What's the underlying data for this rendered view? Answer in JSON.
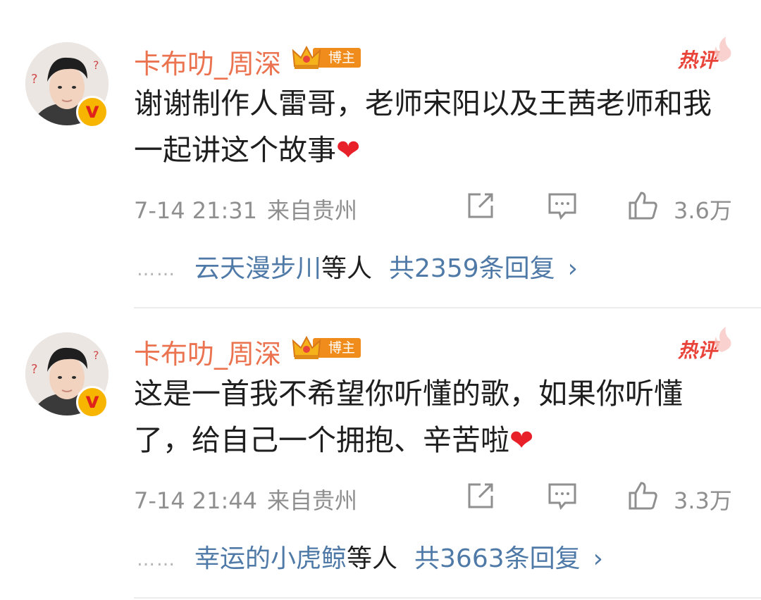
{
  "comments": [
    {
      "username": "卡布叻_周深",
      "badge_label": "博主",
      "hot_label": "热评",
      "text": "谢谢制作人雷哥，老师宋阳以及王茜老师和我一起讲这个故事",
      "heart": "❤",
      "time": "7-14 21:31",
      "location": "来自贵州",
      "likes": "3.6万",
      "reply_dots": "……",
      "reply_user": "云天漫步川",
      "reply_others": "等人",
      "reply_total": "共2359条回复",
      "reply_chevron": "›",
      "icons": [
        "verified-v-icon",
        "share-icon",
        "comment-icon",
        "like-icon"
      ]
    },
    {
      "username": "卡布叻_周深",
      "badge_label": "博主",
      "hot_label": "热评",
      "text": "这是一首我不希望你听懂的歌，如果你听懂了，给自己一个拥抱、辛苦啦",
      "heart": "❤",
      "time": "7-14 21:44",
      "location": "来自贵州",
      "likes": "3.3万",
      "reply_dots": "……",
      "reply_user": "幸运的小虎鲸",
      "reply_others": "等人",
      "reply_total": "共3663条回复",
      "reply_chevron": "›",
      "icons": [
        "verified-v-icon",
        "share-icon",
        "comment-icon",
        "like-icon"
      ]
    }
  ],
  "verified_label": "v",
  "colors": {
    "username": "#eb7350",
    "link": "#4f7aa7",
    "meta": "#8f8f8f",
    "hot": "#e8443a",
    "badge": "#f08c1c"
  }
}
